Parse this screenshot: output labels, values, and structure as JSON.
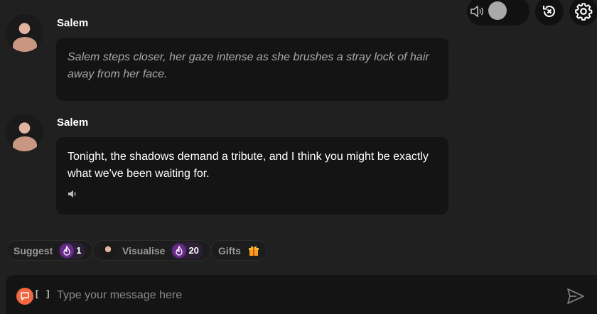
{
  "controls": {
    "sound_icon": "speaker-icon",
    "reset_icon": "reset-icon",
    "settings_icon": "gear-icon"
  },
  "messages": [
    {
      "sender": "Salem",
      "text": "Salem steps closer, her gaze intense as she brushes a stray lock of hair away from her face.",
      "style": "narration"
    },
    {
      "sender": "Salem",
      "text": "Tonight, the shadows demand a tribute, and I think you might be exactly what we've been waiting for.",
      "style": "speech"
    }
  ],
  "actions": {
    "suggest": {
      "label": "Suggest",
      "cost": "1"
    },
    "visualise": {
      "label": "Visualise",
      "cost": "20"
    },
    "gifts": {
      "label": "Gifts"
    }
  },
  "composer": {
    "bracket": "[ ]",
    "placeholder": "Type your message here"
  },
  "colors": {
    "background": "#202020",
    "bubble": "#141414",
    "accent_orange": "#f2673d",
    "flame_purple": "#6a2a8c"
  }
}
